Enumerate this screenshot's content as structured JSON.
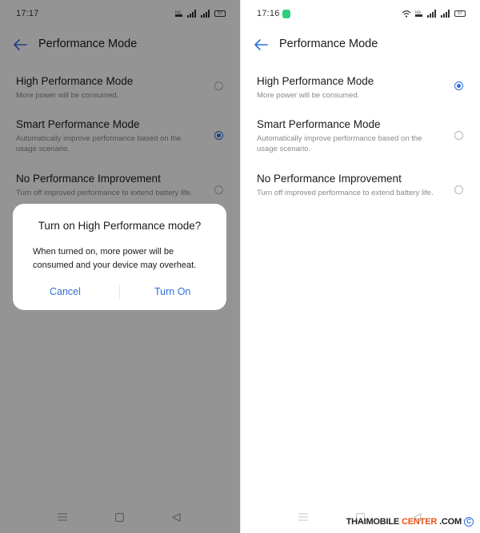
{
  "left_screen": {
    "status": {
      "time": "17:17",
      "battery": "57"
    },
    "appbar": {
      "title": "Performance Mode"
    },
    "options": [
      {
        "title": "High Performance Mode",
        "description": "More power will be consumed.",
        "selected": false
      },
      {
        "title": "Smart Performance Mode",
        "description": "Automatically improve performance based on the usage scenario.",
        "selected": true
      },
      {
        "title": "No Performance Improvement",
        "description": "Turn off improved performance to extend battery life.",
        "selected": false
      }
    ],
    "dialog": {
      "title": "Turn on High Performance mode?",
      "message": "When turned on, more power will be consumed and your device may overheat.",
      "cancel_label": "Cancel",
      "confirm_label": "Turn On"
    }
  },
  "right_screen": {
    "status": {
      "time": "17:16",
      "battery": "57"
    },
    "appbar": {
      "title": "Performance Mode"
    },
    "options": [
      {
        "title": "High Performance Mode",
        "description": "More power will be consumed.",
        "selected": true
      },
      {
        "title": "Smart Performance Mode",
        "description": "Automatically improve performance based on the usage scenario.",
        "selected": false
      },
      {
        "title": "No Performance Improvement",
        "description": "Turn off improved performance to extend battery life.",
        "selected": false
      }
    ]
  },
  "watermark": {
    "part1": "THAIMOBILE",
    "part2": "CENTER",
    "part3": ".COM",
    "symbol": "C"
  },
  "colors": {
    "accent": "#2f6fde",
    "scrim": "rgba(0,0,0,0.42)",
    "watermark_accent": "#e7531a"
  },
  "icons": {
    "back": "arrow-left",
    "nav_menu": "hamburger",
    "nav_home": "square",
    "nav_back": "triangle-left",
    "wifi": "wifi",
    "signal": "cell-signal",
    "battery": "battery"
  }
}
